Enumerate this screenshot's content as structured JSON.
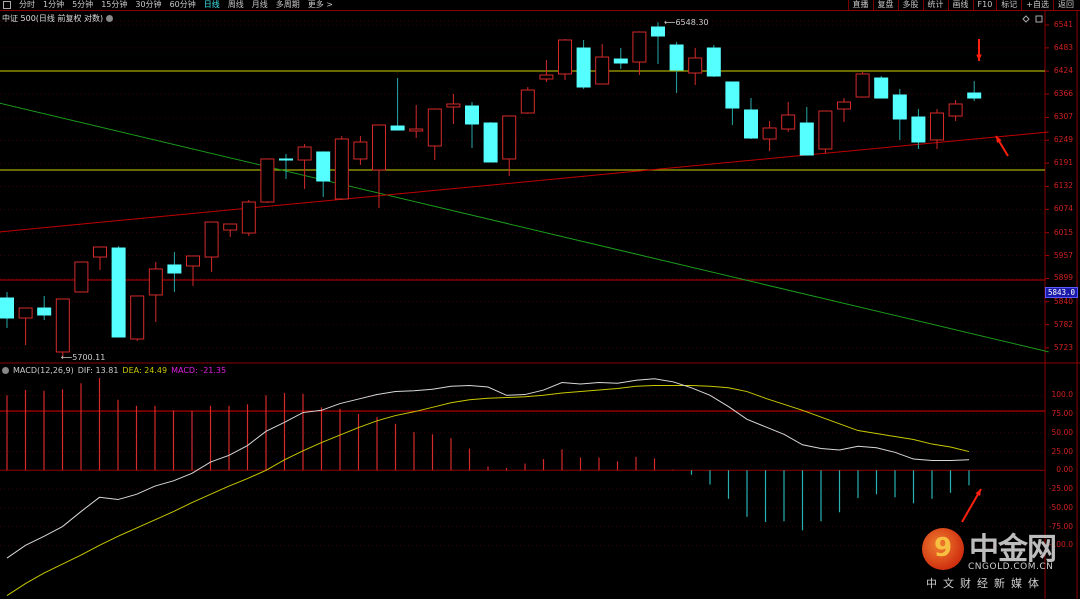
{
  "toolbar": {
    "left_items": [
      "分时",
      "1分钟",
      "5分钟",
      "15分钟",
      "30分钟",
      "60分钟",
      "日线",
      "周线",
      "月线",
      "多周期",
      "更多 >"
    ],
    "active": "日线",
    "right_items": [
      "直播",
      "复盘",
      "多股",
      "统计",
      "画线",
      "F10",
      "标记",
      "+自选",
      "返回"
    ]
  },
  "title": "中证 500(日线 前复权 对数)",
  "macd_header": {
    "name": "MACD(12,26,9)",
    "dif": "DIF: 13.81",
    "dea": "DEA: 24.49",
    "macd": "MACD: -21.35"
  },
  "colors": {
    "up": "#d42a2a",
    "down": "#55ffff",
    "dif": "#d8d8d8",
    "dea": "#c8c800",
    "macd_text": "#e020e0",
    "axis": "#d02020",
    "trend_green": "#1a9a1a",
    "trend_red": "#c00000",
    "hline_yellow": "#a8a800"
  },
  "current_price_label": "5843.0",
  "watermark": {
    "brand": "中金网",
    "domain": "CNGOLD.COM.CN",
    "tagline": "中文财经新媒体"
  },
  "chart_data": [
    {
      "type": "candlestick",
      "title": "中证 500(日线 前复权 对数)",
      "y_ticks": [
        "6541",
        "6483",
        "6424",
        "6366",
        "6307",
        "6249",
        "6191",
        "6132",
        "6074",
        "6015",
        "5957",
        "5899",
        "5840",
        "5782",
        "5723"
      ],
      "ylim": [
        5690,
        6560
      ],
      "annotations": {
        "high_label": "6548.30",
        "high_value": 6548.3,
        "low_label": "5700.11",
        "low_value": 5700.11,
        "high_index": 35,
        "low_index": 3
      },
      "horizontal_lines": [
        {
          "color": "yellow",
          "value": 6424.5
        },
        {
          "color": "yellow",
          "value": 6173.7
        },
        {
          "color": "red",
          "value": 5895
        }
      ],
      "trend_lines": [
        {
          "color": "green",
          "from_index": -0.4,
          "from": 6343,
          "to_index": 56,
          "to": 5713
        },
        {
          "color": "red",
          "from_index": -0.4,
          "from": 6017,
          "to_index": 56,
          "to": 6270
        }
      ],
      "ohlc": [
        [
          5849.5,
          5864.7,
          5773.5,
          5798.8
        ],
        [
          5798.8,
          5824.1,
          5730.4,
          5824.1
        ],
        [
          5824.1,
          5854.6,
          5793.7,
          5806.4
        ],
        [
          5712.7,
          5846.9,
          5700.1,
          5846.9
        ],
        [
          5864.7,
          5940.6,
          5864.0,
          5940.6
        ],
        [
          5953.3,
          5978.6,
          5920.4,
          5978.6
        ],
        [
          5976.1,
          5981.0,
          5750.0,
          5750.7
        ],
        [
          5745.6,
          5854.6,
          5740.6,
          5854.6
        ],
        [
          5857.1,
          5940.6,
          5788.7,
          5923.0
        ],
        [
          5933.1,
          5966.0,
          5864.7,
          5912.8
        ],
        [
          5930.5,
          5955.9,
          5879.9,
          5955.9
        ],
        [
          5953.3,
          6043.0,
          5915.3,
          6041.9
        ],
        [
          6021.7,
          6037.0,
          6004.0,
          6036.9
        ],
        [
          6014.1,
          6097.7,
          6006.5,
          6092.6
        ],
        [
          6092.6,
          6203.0,
          6090.0,
          6201.6
        ],
        [
          6201.6,
          6214.2,
          6150.9,
          6199.0
        ],
        [
          6199.0,
          6239.5,
          6125.6,
          6231.9
        ],
        [
          6219.3,
          6221.0,
          6105.3,
          6145.8
        ],
        [
          6100.2,
          6259.8,
          6097.7,
          6252.2
        ],
        [
          6201.6,
          6259.8,
          6186.4,
          6244.6
        ],
        [
          6173.7,
          6289.0,
          6077.4,
          6287.7
        ],
        [
          6285.1,
          6406.7,
          6275.0,
          6275.0
        ],
        [
          6272.5,
          6338.3,
          6254.7,
          6277.5
        ],
        [
          6234.5,
          6330.0,
          6199.0,
          6328.2
        ],
        [
          6333.3,
          6366.2,
          6290.2,
          6340.9
        ],
        [
          6335.8,
          6345.9,
          6229.4,
          6290.2
        ],
        [
          6292.7,
          6295.0,
          6194.0,
          6194.0
        ],
        [
          6201.6,
          6312.0,
          6158.5,
          6310.5
        ],
        [
          6318.1,
          6383.9,
          6316.0,
          6376.3
        ],
        [
          6404.2,
          6452.3,
          6396.6,
          6414.3
        ],
        [
          6416.9,
          6505.5,
          6401.7,
          6503.0
        ],
        [
          6482.7,
          6503.0,
          6378.9,
          6383.9
        ],
        [
          6391.5,
          6492.8,
          6390.0,
          6459.9
        ],
        [
          6454.8,
          6482.7,
          6429.5,
          6444.7
        ],
        [
          6447.2,
          6525.0,
          6414.3,
          6523.2
        ],
        [
          6535.9,
          6548.3,
          6442.2,
          6513.1
        ],
        [
          6490.3,
          6497.9,
          6368.7,
          6427.0
        ],
        [
          6419.4,
          6482.7,
          6389.0,
          6457.4
        ],
        [
          6482.7,
          6490.3,
          6409.2,
          6411.8
        ],
        [
          6396.6,
          6398.0,
          6287.7,
          6330.7
        ],
        [
          6325.7,
          6356.0,
          6252.2,
          6254.7
        ],
        [
          6252.2,
          6297.8,
          6221.8,
          6280.1
        ],
        [
          6277.5,
          6345.9,
          6270.0,
          6313.0
        ],
        [
          6292.7,
          6333.3,
          6210.0,
          6211.7
        ],
        [
          6226.9,
          6324.0,
          6216.7,
          6323.1
        ],
        [
          6328.2,
          6356.0,
          6295.3,
          6345.9
        ],
        [
          6358.6,
          6421.9,
          6357.0,
          6416.9
        ],
        [
          6406.7,
          6411.8,
          6355.0,
          6356.0
        ],
        [
          6363.7,
          6378.9,
          6249.7,
          6302.9
        ],
        [
          6307.9,
          6328.2,
          6226.9,
          6244.6
        ],
        [
          6249.7,
          6328.2,
          6226.9,
          6318.1
        ],
        [
          6310.5,
          6351.0,
          6297.8,
          6340.9
        ],
        [
          6368.7,
          6399.1,
          6348.5,
          6356.0
        ]
      ]
    },
    {
      "type": "macd",
      "y_ticks": [
        "100.0",
        "75.00",
        "50.00",
        "25.00",
        "0.00",
        "-25.00",
        "-50.00",
        "-75.00",
        "-100.0"
      ],
      "ylim": [
        -125,
        125
      ],
      "reference_line": 79,
      "histogram": [
        100,
        107,
        106,
        108,
        116,
        123,
        94,
        86,
        86,
        80,
        79,
        86,
        86,
        88,
        100,
        103,
        102,
        84,
        82,
        75,
        71,
        62,
        51,
        48,
        43,
        29,
        5,
        3,
        9,
        15,
        28,
        17,
        17,
        12,
        18,
        16,
        1,
        -6,
        -19,
        -38,
        -62,
        -69,
        -68,
        -80,
        -68,
        -56,
        -37,
        -32,
        -36,
        -44,
        -38,
        -30,
        -20
      ],
      "dif": [
        -117,
        -100,
        -88,
        -75,
        -55,
        -36,
        -39,
        -32,
        -21,
        -14,
        -4,
        11,
        20,
        33,
        52,
        64,
        77,
        80,
        89,
        95,
        101,
        105,
        106,
        108,
        112,
        113,
        111,
        100,
        101,
        107,
        117,
        115,
        117,
        116,
        120,
        122,
        118,
        110,
        100,
        85,
        68,
        58,
        48,
        34,
        29,
        27,
        32,
        30,
        24,
        15,
        13,
        13,
        14
      ],
      "dea": [
        -167,
        -151,
        -137,
        -125,
        -113,
        -100,
        -88,
        -77,
        -66,
        -55,
        -43,
        -32,
        -21,
        -11,
        0,
        14,
        26,
        37,
        47,
        57,
        66,
        73,
        78,
        84,
        90,
        94,
        96,
        97,
        98,
        100,
        103,
        105,
        107,
        109,
        112,
        113,
        113,
        113,
        112,
        110,
        105,
        96,
        88,
        80,
        71,
        62,
        53,
        49,
        45,
        41,
        35,
        31,
        25
      ]
    }
  ]
}
